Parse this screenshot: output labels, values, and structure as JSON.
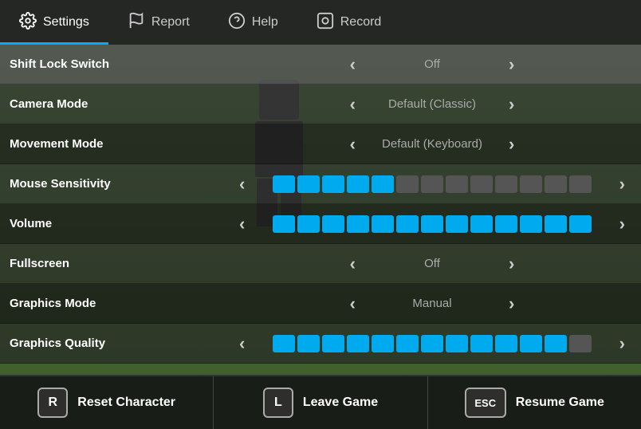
{
  "nav": {
    "items": [
      {
        "id": "settings",
        "label": "Settings",
        "icon": "⚙",
        "active": true
      },
      {
        "id": "report",
        "label": "Report",
        "icon": "⚑",
        "active": false
      },
      {
        "id": "help",
        "label": "Help",
        "icon": "?",
        "active": false
      },
      {
        "id": "record",
        "label": "Record",
        "icon": "◎",
        "active": false
      }
    ]
  },
  "settings": [
    {
      "id": "shift-lock",
      "label": "Shift Lock Switch",
      "type": "toggle",
      "value": "Off"
    },
    {
      "id": "camera-mode",
      "label": "Camera Mode",
      "type": "toggle",
      "value": "Default (Classic)"
    },
    {
      "id": "movement-mode",
      "label": "Movement Mode",
      "type": "toggle",
      "value": "Default (Keyboard)"
    },
    {
      "id": "mouse-sensitivity",
      "label": "Mouse Sensitivity",
      "type": "slider",
      "activeSegs": 5,
      "totalSegs": 13
    },
    {
      "id": "volume",
      "label": "Volume",
      "type": "slider",
      "activeSegs": 13,
      "totalSegs": 13
    },
    {
      "id": "fullscreen",
      "label": "Fullscreen",
      "type": "toggle",
      "value": "Off"
    },
    {
      "id": "graphics-mode",
      "label": "Graphics Mode",
      "type": "toggle",
      "value": "Manual"
    },
    {
      "id": "graphics-quality",
      "label": "Graphics Quality",
      "type": "slider",
      "activeSegs": 12,
      "totalSegs": 13
    }
  ],
  "actions": [
    {
      "id": "reset",
      "key": "R",
      "label": "Reset Character",
      "wide": false
    },
    {
      "id": "leave",
      "key": "L",
      "label": "Leave Game",
      "wide": false
    },
    {
      "id": "resume",
      "key": "ESC",
      "label": "Resume Game",
      "wide": true
    }
  ]
}
